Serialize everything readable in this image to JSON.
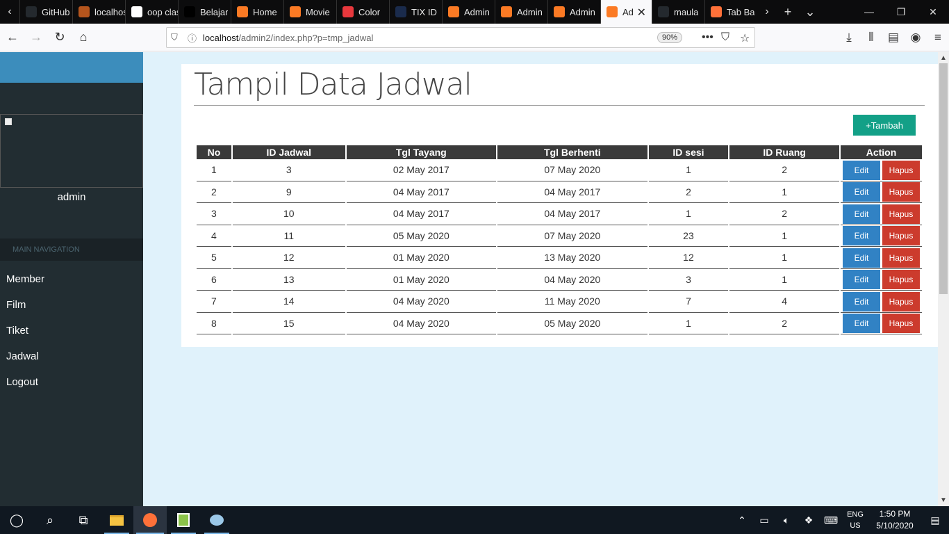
{
  "browser": {
    "tabs": [
      {
        "label": "GitHub",
        "icon": "github-icon",
        "color": "#24292e"
      },
      {
        "label": "localhost",
        "icon": "localhost-icon",
        "color": "#b5551d"
      },
      {
        "label": "oop class",
        "icon": "google-icon",
        "color": "#ffffff"
      },
      {
        "label": "Belajar",
        "icon": "belajar-icon",
        "color": "#000000"
      },
      {
        "label": "Home",
        "icon": "xampp-icon",
        "color": "#fb7a24"
      },
      {
        "label": "Movie",
        "icon": "xampp-icon",
        "color": "#fb7a24"
      },
      {
        "label": "Color",
        "icon": "color-icon",
        "color": "#e8383d"
      },
      {
        "label": "TIX ID",
        "icon": "tix-icon",
        "color": "#1a2b4c"
      },
      {
        "label": "Admin",
        "icon": "xampp-icon",
        "color": "#fb7a24"
      },
      {
        "label": "Admin",
        "icon": "xampp-icon",
        "color": "#fb7a24"
      },
      {
        "label": "Admin",
        "icon": "xampp-icon",
        "color": "#fb7a24"
      },
      {
        "label": "Ad",
        "icon": "xampp-icon",
        "color": "#fb7a24",
        "active": true
      },
      {
        "label": "maula",
        "icon": "github-icon",
        "color": "#24292e"
      },
      {
        "label": "Tab Ba",
        "icon": "firefox-icon",
        "color": "#ff7139"
      }
    ],
    "url_host": "localhost",
    "url_path": "/admin2/index.php?p=tmp_jadwal",
    "zoom": "90%"
  },
  "sidebar": {
    "username": "admin",
    "header": "MAIN NAVIGATION",
    "items": [
      {
        "label": "Member"
      },
      {
        "label": "Film"
      },
      {
        "label": "Tiket"
      },
      {
        "label": "Jadwal"
      },
      {
        "label": "Logout"
      }
    ]
  },
  "main": {
    "title": "Tampil Data Jadwal",
    "add_label": "+Tambah",
    "columns": [
      "No",
      "ID Jadwal",
      "Tgl Tayang",
      "Tgl Berhenti",
      "ID sesi",
      "ID Ruang",
      "Action"
    ],
    "edit_label": "Edit",
    "delete_label": "Hapus",
    "rows": [
      {
        "no": "1",
        "id_jadwal": "3",
        "tgl_tayang": "02 May 2017",
        "tgl_berhenti": "07 May 2020",
        "id_sesi": "1",
        "id_ruang": "2"
      },
      {
        "no": "2",
        "id_jadwal": "9",
        "tgl_tayang": "04 May 2017",
        "tgl_berhenti": "04 May 2017",
        "id_sesi": "2",
        "id_ruang": "1"
      },
      {
        "no": "3",
        "id_jadwal": "10",
        "tgl_tayang": "04 May 2017",
        "tgl_berhenti": "04 May 2017",
        "id_sesi": "1",
        "id_ruang": "2"
      },
      {
        "no": "4",
        "id_jadwal": "11",
        "tgl_tayang": "05 May 2020",
        "tgl_berhenti": "07 May 2020",
        "id_sesi": "23",
        "id_ruang": "1"
      },
      {
        "no": "5",
        "id_jadwal": "12",
        "tgl_tayang": "01 May 2020",
        "tgl_berhenti": "13 May 2020",
        "id_sesi": "12",
        "id_ruang": "1"
      },
      {
        "no": "6",
        "id_jadwal": "13",
        "tgl_tayang": "01 May 2020",
        "tgl_berhenti": "04 May 2020",
        "id_sesi": "3",
        "id_ruang": "1"
      },
      {
        "no": "7",
        "id_jadwal": "14",
        "tgl_tayang": "04 May 2020",
        "tgl_berhenti": "11 May 2020",
        "id_sesi": "7",
        "id_ruang": "4"
      },
      {
        "no": "8",
        "id_jadwal": "15",
        "tgl_tayang": "04 May 2020",
        "tgl_berhenti": "05 May 2020",
        "id_sesi": "1",
        "id_ruang": "2"
      }
    ]
  },
  "taskbar": {
    "lang_line1": "ENG",
    "lang_line2": "US",
    "time": "1:50 PM",
    "date": "5/10/2020"
  },
  "colors": {
    "sidebar_bg": "#222d32",
    "sidebar_top": "#3c8dbc",
    "page_bg": "#e0f2fb",
    "add_button": "#13a087",
    "edit_button": "#3182c4",
    "delete_button": "#cc3b2d",
    "table_header": "#3a3a3a"
  }
}
